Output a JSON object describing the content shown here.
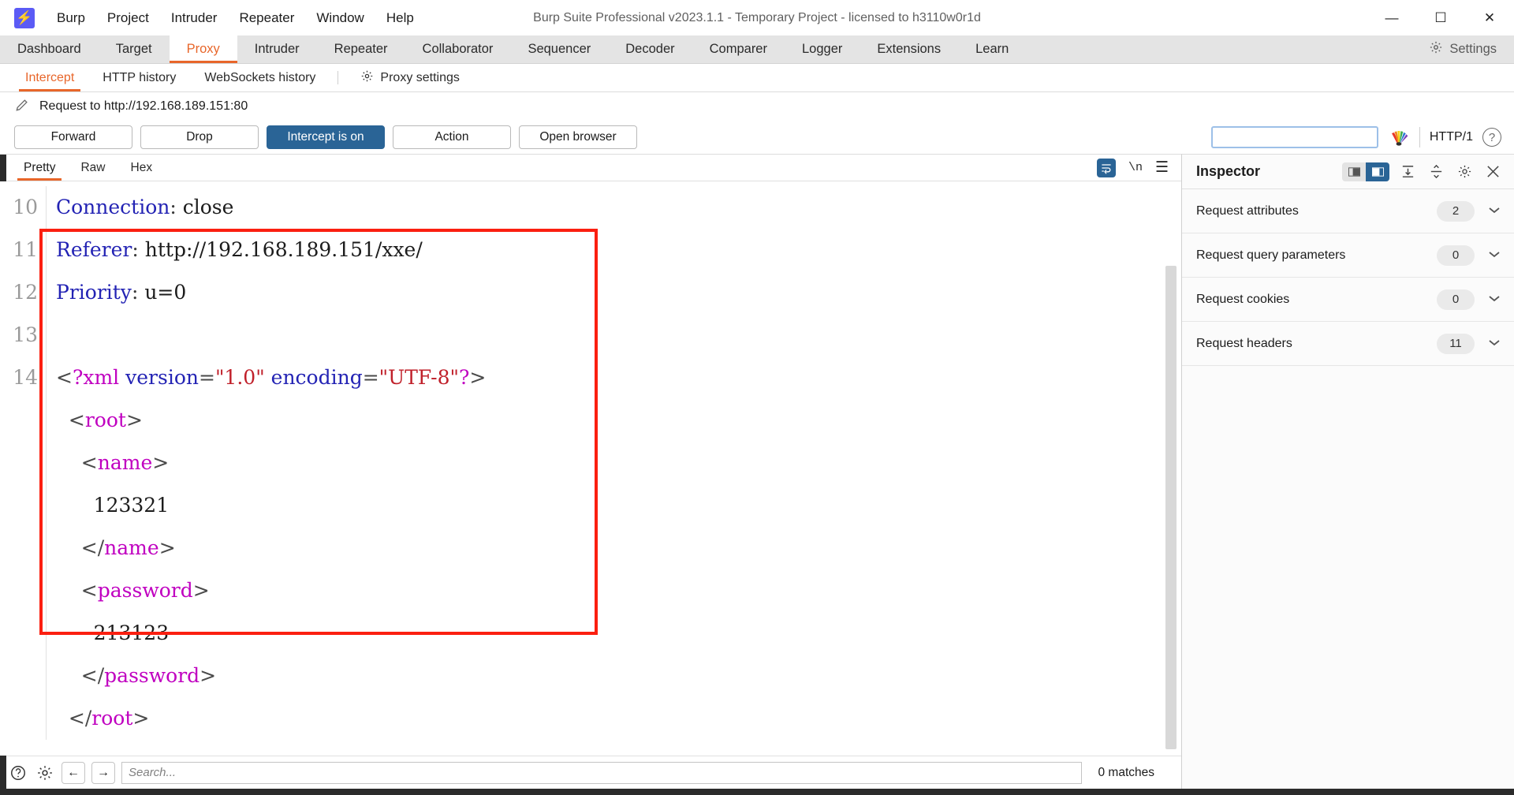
{
  "app": {
    "logo_icon": "burp-bolt-icon",
    "title": "Burp Suite Professional v2023.1.1 - Temporary Project - licensed to h3110w0r1d",
    "menu": [
      "Burp",
      "Project",
      "Intruder",
      "Repeater",
      "Window",
      "Help"
    ],
    "window_controls": {
      "minimize": "—",
      "maximize": "☐",
      "close": "✕"
    }
  },
  "main_tabs": {
    "items": [
      "Dashboard",
      "Target",
      "Proxy",
      "Intruder",
      "Repeater",
      "Collaborator",
      "Sequencer",
      "Decoder",
      "Comparer",
      "Logger",
      "Extensions",
      "Learn"
    ],
    "active": "Proxy",
    "settings_label": "Settings",
    "settings_icon": "gear-icon"
  },
  "sub_tabs": {
    "items": [
      "Intercept",
      "HTTP history",
      "WebSockets history"
    ],
    "active": "Intercept",
    "proxy_settings_label": "Proxy settings",
    "proxy_settings_icon": "gear-icon"
  },
  "request_line": {
    "edit_icon": "pencil-icon",
    "text": "Request to http://192.168.189.151:80"
  },
  "actions": {
    "forward": "Forward",
    "drop": "Drop",
    "intercept_toggle": "Intercept is on",
    "action": "Action",
    "open_browser": "Open browser",
    "search_value": "",
    "search_placeholder": "",
    "peacock_icon": "peacock-icon",
    "http_version": "HTTP/1",
    "help_icon": "help-circle-icon"
  },
  "editor": {
    "tabs": [
      "Pretty",
      "Raw",
      "Hex"
    ],
    "active_tab": "Pretty",
    "wrap_icon": "word-wrap-icon",
    "newline_icon": "\\n",
    "menu_icon": "hamburger-menu-icon",
    "lines": [
      {
        "number": "10",
        "tokens": [
          {
            "t": "hdr-name",
            "s": "Connection"
          },
          {
            "t": "punc",
            "s": ": "
          },
          {
            "t": "xml-text",
            "s": "close"
          }
        ]
      },
      {
        "number": "11",
        "tokens": [
          {
            "t": "hdr-name",
            "s": "Referer"
          },
          {
            "t": "punc",
            "s": ": "
          },
          {
            "t": "xml-text",
            "s": "http://192.168.189.151/xxe/"
          }
        ]
      },
      {
        "number": "12",
        "tokens": [
          {
            "t": "hdr-name",
            "s": "Priority"
          },
          {
            "t": "punc",
            "s": ": "
          },
          {
            "t": "xml-text",
            "s": "u=0"
          }
        ]
      },
      {
        "number": "13",
        "tokens": [
          {
            "t": "xml-text",
            "s": ""
          }
        ]
      },
      {
        "number": "14",
        "tokens": [
          {
            "t": "xml-angle",
            "s": "<"
          },
          {
            "t": "xml-tag",
            "s": "?xml"
          },
          {
            "t": "xml-text",
            "s": " "
          },
          {
            "t": "xml-attr",
            "s": "version"
          },
          {
            "t": "xml-angle",
            "s": "="
          },
          {
            "t": "xml-val",
            "s": "\"1.0\""
          },
          {
            "t": "xml-text",
            "s": " "
          },
          {
            "t": "xml-attr",
            "s": "encoding"
          },
          {
            "t": "xml-angle",
            "s": "="
          },
          {
            "t": "xml-val",
            "s": "\"UTF-8\""
          },
          {
            "t": "xml-tag",
            "s": "?"
          },
          {
            "t": "xml-angle",
            "s": ">"
          }
        ]
      },
      {
        "number": "",
        "tokens": [
          {
            "t": "xml-text",
            "s": "  "
          },
          {
            "t": "xml-angle",
            "s": "<"
          },
          {
            "t": "xml-tag",
            "s": "root"
          },
          {
            "t": "xml-angle",
            "s": ">"
          }
        ]
      },
      {
        "number": "",
        "tokens": [
          {
            "t": "xml-text",
            "s": "    "
          },
          {
            "t": "xml-angle",
            "s": "<"
          },
          {
            "t": "xml-tag",
            "s": "name"
          },
          {
            "t": "xml-angle",
            "s": ">"
          }
        ]
      },
      {
        "number": "",
        "tokens": [
          {
            "t": "xml-text",
            "s": "      123321"
          }
        ]
      },
      {
        "number": "",
        "tokens": [
          {
            "t": "xml-text",
            "s": "    "
          },
          {
            "t": "xml-angle",
            "s": "</"
          },
          {
            "t": "xml-tag",
            "s": "name"
          },
          {
            "t": "xml-angle",
            "s": ">"
          }
        ]
      },
      {
        "number": "",
        "tokens": [
          {
            "t": "xml-text",
            "s": "    "
          },
          {
            "t": "xml-angle",
            "s": "<"
          },
          {
            "t": "xml-tag",
            "s": "password"
          },
          {
            "t": "xml-angle",
            "s": ">"
          }
        ]
      },
      {
        "number": "",
        "tokens": [
          {
            "t": "xml-text",
            "s": "      213123"
          }
        ]
      },
      {
        "number": "",
        "tokens": [
          {
            "t": "xml-text",
            "s": "    "
          },
          {
            "t": "xml-angle",
            "s": "</"
          },
          {
            "t": "xml-tag",
            "s": "password"
          },
          {
            "t": "xml-angle",
            "s": ">"
          }
        ]
      },
      {
        "number": "",
        "tokens": [
          {
            "t": "xml-text",
            "s": "  "
          },
          {
            "t": "xml-angle",
            "s": "</"
          },
          {
            "t": "xml-tag",
            "s": "root"
          },
          {
            "t": "xml-angle",
            "s": ">"
          }
        ]
      }
    ]
  },
  "annotation": {
    "highlight_color": "#fb1f10"
  },
  "bottom_bar": {
    "help_icon": "help-circle-icon",
    "settings_icon": "gear-icon",
    "prev_icon": "arrow-left-icon",
    "next_icon": "arrow-right-icon",
    "search_value": "",
    "search_placeholder": "Search...",
    "matches": "0 matches"
  },
  "inspector": {
    "title": "Inspector",
    "layout_icons": [
      "panel-left-icon",
      "panel-right-icon"
    ],
    "expand_icon": "expand-all-icon",
    "collapse_icon": "collapse-all-icon",
    "settings_icon": "gear-icon",
    "close_icon": "close-icon",
    "rows": [
      {
        "label": "Request attributes",
        "count": "2"
      },
      {
        "label": "Request query parameters",
        "count": "0"
      },
      {
        "label": "Request cookies",
        "count": "0"
      },
      {
        "label": "Request headers",
        "count": "11"
      }
    ]
  },
  "colors": {
    "accent_orange": "#e8662a",
    "primary_blue": "#2a6496",
    "logo_purple": "#5b5bf5",
    "annotation_red": "#fb1f10"
  }
}
